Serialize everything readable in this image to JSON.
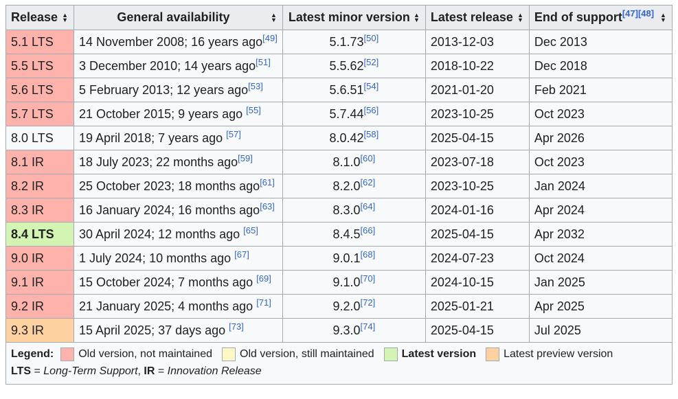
{
  "headers": [
    "Release",
    "General availability",
    "Latest minor version",
    "Latest release",
    "End of support"
  ],
  "eos_refs": "[47][48]",
  "colors": {
    "old": "#fdb3ab",
    "maintained": "#fef8c6",
    "latest": "#d4f4b4",
    "preview": "#fed1a0"
  },
  "rows": [
    {
      "status": "old",
      "release": "5.1 LTS",
      "ga": "14 November 2008; 16 years ago",
      "ga_ref": "[49]",
      "minor": "5.1.73",
      "minor_ref": "[50]",
      "latest": "2013-12-03",
      "eos": "Dec 2013"
    },
    {
      "status": "old",
      "release": "5.5 LTS",
      "ga": "3 December 2010; 14 years ago",
      "ga_ref": "[51]",
      "minor": "5.5.62",
      "minor_ref": "[52]",
      "latest": "2018-10-22",
      "eos": "Dec 2018"
    },
    {
      "status": "old",
      "release": "5.6 LTS",
      "ga": "5 February 2013; 12 years ago",
      "ga_ref": "[53]",
      "minor": "5.6.51",
      "minor_ref": "[54]",
      "latest": "2021-01-20",
      "eos": "Feb 2021"
    },
    {
      "status": "old",
      "release": "5.7 LTS",
      "ga": "21 October 2015; 9 years ago ",
      "ga_ref": "[55]",
      "minor": "5.7.44",
      "minor_ref": "[56]",
      "latest": "2023-10-25",
      "eos": "Oct 2023"
    },
    {
      "status": "maintained",
      "release": "8.0 LTS",
      "ga": "19 April 2018; 7 years ago ",
      "ga_ref": "[57]",
      "minor": "8.0.42",
      "minor_ref": "[58]",
      "latest": "2025-04-15",
      "eos": "Apr 2026"
    },
    {
      "status": "old",
      "release": "8.1 IR",
      "ga": "18 July 2023; 22 months ago",
      "ga_ref": "[59]",
      "minor": "8.1.0",
      "minor_ref": "[60]",
      "latest": "2023-07-18",
      "eos": "Oct 2023"
    },
    {
      "status": "old",
      "release": "8.2 IR",
      "ga": "25 October 2023; 18 months ago",
      "ga_ref": "[61]",
      "minor": "8.2.0",
      "minor_ref": "[62]",
      "latest": "2023-10-25",
      "eos": "Jan 2024"
    },
    {
      "status": "old",
      "release": "8.3 IR",
      "ga": "16 January 2024; 16 months ago",
      "ga_ref": "[63]",
      "minor": "8.3.0",
      "minor_ref": "[64]",
      "latest": "2024-01-16",
      "eos": "Apr 2024"
    },
    {
      "status": "latest",
      "release": "8.4 LTS",
      "ga": "30 April 2024; 12 months ago ",
      "ga_ref": "[65]",
      "minor": "8.4.5",
      "minor_ref": "[66]",
      "latest": "2025-04-15",
      "eos": "Apr 2032"
    },
    {
      "status": "old",
      "release": "9.0 IR",
      "ga": "1 July 2024; 10 months ago ",
      "ga_ref": "[67]",
      "minor": "9.0.1",
      "minor_ref": "[68]",
      "latest": "2024-07-23",
      "eos": "Oct 2024"
    },
    {
      "status": "old",
      "release": "9.1 IR",
      "ga": "15 October 2024; 7 months ago ",
      "ga_ref": "[69]",
      "minor": "9.1.0",
      "minor_ref": "[70]",
      "latest": "2024-10-15",
      "eos": "Jan 2025"
    },
    {
      "status": "old",
      "release": "9.2 IR",
      "ga": "21 January 2025; 4 months ago ",
      "ga_ref": "[71]",
      "minor": "9.2.0",
      "minor_ref": "[72]",
      "latest": "2025-01-21",
      "eos": "Apr 2025"
    },
    {
      "status": "preview",
      "release": "9.3 IR",
      "ga": "15 April 2025; 37 days ago ",
      "ga_ref": "[73]",
      "minor": "9.3.0",
      "minor_ref": "[74]",
      "latest": "2025-04-15",
      "eos": "Jul 2025"
    }
  ],
  "legend": {
    "label": "Legend:",
    "old": "Old version, not maintained",
    "maintained": "Old version, still maintained",
    "latest": "Latest version",
    "preview": "Latest preview version",
    "lts_abbr": "LTS",
    "lts_text": " = ",
    "lts_full": "Long-Term Support",
    "sep": ", ",
    "ir_abbr": "IR",
    "ir_text": " = ",
    "ir_full": "Innovation Release"
  }
}
